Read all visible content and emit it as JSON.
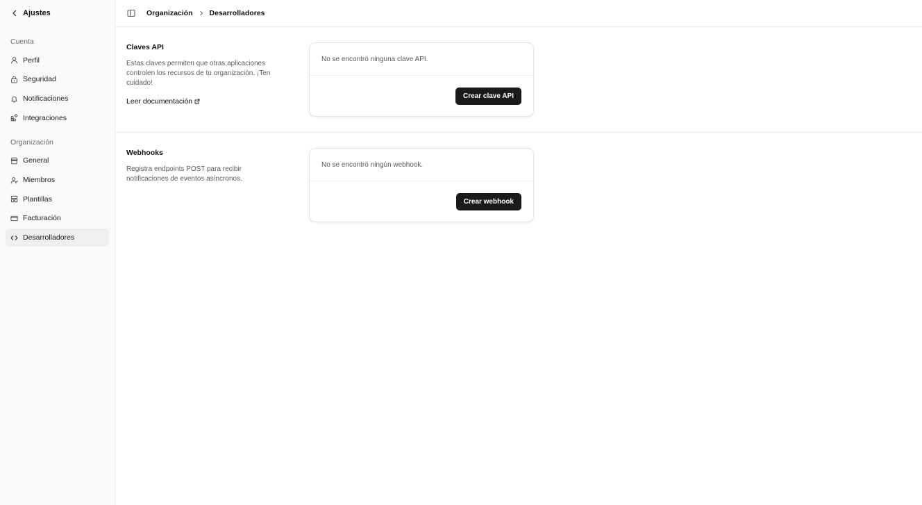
{
  "sidebar": {
    "back_label": "Ajustes",
    "groups": [
      {
        "label": "Cuenta",
        "items": [
          {
            "label": "Perfil",
            "icon": "user-icon"
          },
          {
            "label": "Seguridad",
            "icon": "lock-icon"
          },
          {
            "label": "Notificaciones",
            "icon": "bell-icon"
          },
          {
            "label": "Integraciones",
            "icon": "puzzle-icon"
          }
        ]
      },
      {
        "label": "Organización",
        "items": [
          {
            "label": "General",
            "icon": "store-icon"
          },
          {
            "label": "Miembros",
            "icon": "users-icon"
          },
          {
            "label": "Plantillas",
            "icon": "layout-icon"
          },
          {
            "label": "Facturación",
            "icon": "credit-card-icon"
          },
          {
            "label": "Desarrolladores",
            "icon": "code-icon",
            "active": true
          }
        ]
      }
    ]
  },
  "header": {
    "breadcrumb": [
      "Organización",
      "Desarrolladores"
    ]
  },
  "sections": {
    "api_keys": {
      "title": "Claves API",
      "description": "Estas claves permiten que otras aplicaciones controlen los recursos de tu organización. ¡Ten cuidado!",
      "link_label": "Leer documentación",
      "empty_text": "No se encontró ninguna clave API.",
      "button_label": "Crear clave API"
    },
    "webhooks": {
      "title": "Webhooks",
      "description": "Registra endpoints POST para recibir notificaciones de eventos asíncronos.",
      "empty_text": "No se encontró ningún webhook.",
      "button_label": "Crear webhook"
    }
  },
  "colors": {
    "accent": "#1a1a1a",
    "sidebar_bg": "#fafafa",
    "active_item_bg": "#efefef"
  }
}
